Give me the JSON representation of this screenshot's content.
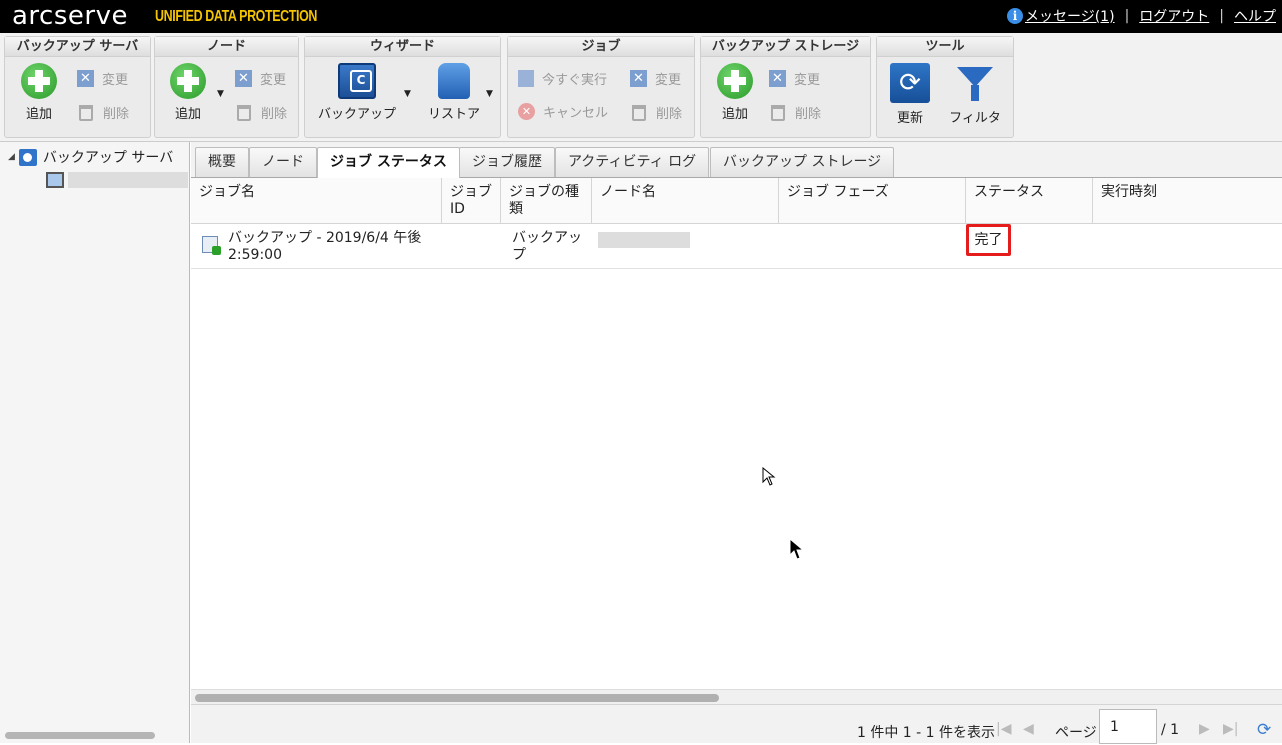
{
  "header": {
    "logo": "arcserve",
    "logo_sub": "UNIFIED DATA PROTECTION",
    "messages": "メッセージ(1)",
    "logout": "ログアウト",
    "help": "ヘルプ",
    "separator": "|"
  },
  "toolbar": {
    "backup_server": {
      "title": "バックアップ サーバ",
      "add": "追加",
      "edit": "変更",
      "delete": "削除"
    },
    "node": {
      "title": "ノード",
      "add": "追加",
      "edit": "変更",
      "delete": "削除"
    },
    "wizard": {
      "title": "ウィザード",
      "backup": "バックアップ",
      "restore": "リストア"
    },
    "job": {
      "title": "ジョブ",
      "run_now": "今すぐ実行",
      "edit": "変更",
      "cancel": "キャンセル",
      "delete": "削除"
    },
    "storage": {
      "title": "バックアップ ストレージ",
      "add": "追加",
      "edit": "変更",
      "delete": "削除"
    },
    "tools": {
      "title": "ツール",
      "refresh": "更新",
      "filter": "フィルタ"
    }
  },
  "tree": {
    "root": "バックアップ サーバ"
  },
  "tabs": [
    "概要",
    "ノード",
    "ジョブ ステータス",
    "ジョブ履歴",
    "アクティビティ ログ",
    "バックアップ ストレージ"
  ],
  "active_tab": "ジョブ ステータス",
  "grid": {
    "columns": [
      "ジョブ名",
      "ジョブ ID",
      "ジョブの種類",
      "ノード名",
      "ジョブ フェーズ",
      "ステータス",
      "実行時刻"
    ],
    "rows": [
      {
        "job_name": "バックアップ - 2019/6/4 午後 2:59:00",
        "job_id": "",
        "job_type": "バックアップ",
        "node_name": "",
        "job_phase": "",
        "status": "完了",
        "run_time": ""
      }
    ]
  },
  "pager": {
    "info": "1 件中 1 - 1 件を表示",
    "page_label": "ページ",
    "page_value": "1",
    "page_total": "/ 1"
  },
  "colors": {
    "header_bg": "#000000",
    "logo_accent": "#f5c400",
    "status_highlight": "#e41c1c",
    "add_green": "#2a9a2a"
  }
}
